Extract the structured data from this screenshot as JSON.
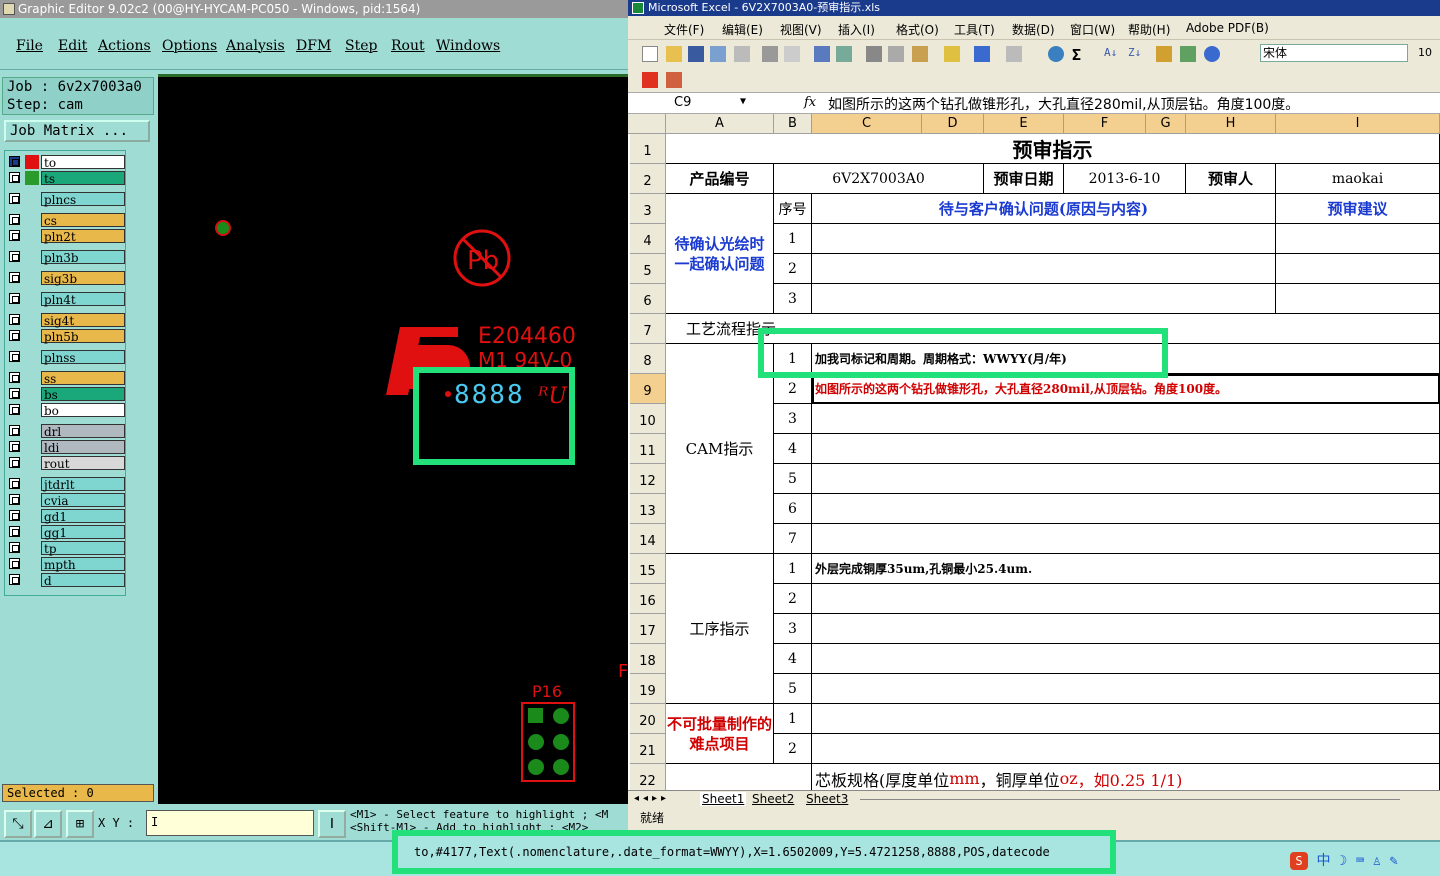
{
  "ge": {
    "title": "Graphic Editor 9.02c2 (00@HY-HYCAM-PC050 - Windows, pid:1564)",
    "menu": [
      "File",
      "Edit",
      "Actions",
      "Options",
      "Analysis",
      "DFM",
      "Step",
      "Rout",
      "Windows"
    ],
    "job_label": "Job : 6v2x7003a0",
    "step_label": "Step: cam",
    "job_matrix": "Job Matrix ...",
    "layers": [
      {
        "name": "to",
        "color": "#ffffff",
        "swatch": "#e01010",
        "active": true
      },
      {
        "name": "ts",
        "color": "#1aa87a",
        "swatch": "#2a9a2a"
      },
      {
        "name": "plncs",
        "color": "#7fd6d0"
      },
      {
        "name": "cs",
        "color": "#e8b84a"
      },
      {
        "name": "pln2t",
        "color": "#e8b84a"
      },
      {
        "name": "pln3b",
        "color": "#7fd6d0"
      },
      {
        "name": "sig3b",
        "color": "#e8b84a"
      },
      {
        "name": "pln4t",
        "color": "#7fd6d0"
      },
      {
        "name": "sig4t",
        "color": "#e8b84a"
      },
      {
        "name": "pln5b",
        "color": "#e8b84a"
      },
      {
        "name": "plnss",
        "color": "#7fd6d0"
      },
      {
        "name": "ss",
        "color": "#e8b84a"
      },
      {
        "name": "bs",
        "color": "#1aa87a"
      },
      {
        "name": "bo",
        "color": "#ffffff"
      },
      {
        "name": "drl",
        "color": "#b0b8c0"
      },
      {
        "name": "ldi",
        "color": "#b0b8c0"
      },
      {
        "name": "rout",
        "color": "#d8d8d8"
      },
      {
        "name": "jtdrlt",
        "color": "#7fd6d0"
      },
      {
        "name": "cvia",
        "color": "#7fd6d0"
      },
      {
        "name": "gd1",
        "color": "#7fd6d0"
      },
      {
        "name": "gg1",
        "color": "#7fd6d0"
      },
      {
        "name": "tp",
        "color": "#7fd6d0"
      },
      {
        "name": "mpth",
        "color": "#7fd6d0"
      },
      {
        "name": "d",
        "color": "#7fd6d0"
      }
    ],
    "selected": "Selected : 0",
    "xy_label": "X Y :",
    "message_line1": "<M1> - Select feature to highlight ; <M",
    "message_line2": "<Shift-M1> - Add to highlight ; <M2>",
    "canvas": {
      "ul_text": "E204460",
      "ul_text2": "M1 94V-0",
      "datecode": "8888",
      "connector_label": "P16",
      "pb_text": "Pb",
      "edge_letter": "F"
    }
  },
  "xl": {
    "title": "Microsoft Excel - 6V2X7003A0-预审指示.xls",
    "menu": [
      "文件(F)",
      "编辑(E)",
      "视图(V)",
      "插入(I)",
      "格式(O)",
      "工具(T)",
      "数据(D)",
      "窗口(W)",
      "帮助(H)",
      "Adobe PDF(B)"
    ],
    "font": "宋体",
    "font_size": "10",
    "namebox": "C9",
    "fx": "fx",
    "formula": "如图所示的这两个钻孔做锥形孔，大孔直径280mil,从顶层钻。角度100度。",
    "columns": [
      "A",
      "B",
      "C",
      "D",
      "E",
      "F",
      "G",
      "H",
      "I"
    ],
    "rows": [
      "1",
      "2",
      "3",
      "4",
      "5",
      "6",
      "7",
      "8",
      "9",
      "10",
      "11",
      "12",
      "13",
      "14",
      "15",
      "16",
      "17",
      "18",
      "19",
      "20",
      "21",
      "22"
    ],
    "cells": {
      "title": "预审指示",
      "product_no_label": "产品编号",
      "product_no": "6V2X7003A0",
      "review_date_label": "预审日期",
      "review_date": "2013-6-10",
      "reviewer_label": "预审人",
      "reviewer": "maokai",
      "seq_label": "序号",
      "confirm_header": "待与客户确认问题(原因与内容)",
      "suggest_header": "预审建议",
      "pending_label": "待确认光绘时一起确认问题",
      "process_label": "工艺流程指示",
      "cam_label": "CAM指示",
      "cam_1": "加我司标记和周期。周期格式：WWYY(月/年)",
      "cam_2": "如图所示的这两个钻孔做锥形孔，大孔直径280mil,从顶层钻。角度100度。",
      "process_step_label": "工序指示",
      "proc_1": "外层完成铜厚35um,孔铜最小25.4um.",
      "difficult_label": "不可批量制作的难点项目",
      "core_spec_a": "芯板规格(厚度单位",
      "core_spec_mm": "mm",
      "core_spec_b": "，铜厚单位",
      "core_spec_oz": "oz",
      "core_spec_c": "，如0.25 1/1)"
    },
    "sheets": [
      "Sheet1",
      "Sheet2",
      "Sheet3"
    ],
    "status": "就绪"
  },
  "statusline": "to,#4177,Text(.nomenclature,.date_format=WWYY),X=1.6502009,Y=5.4721258,8888,POS,datecode",
  "tray": "中"
}
